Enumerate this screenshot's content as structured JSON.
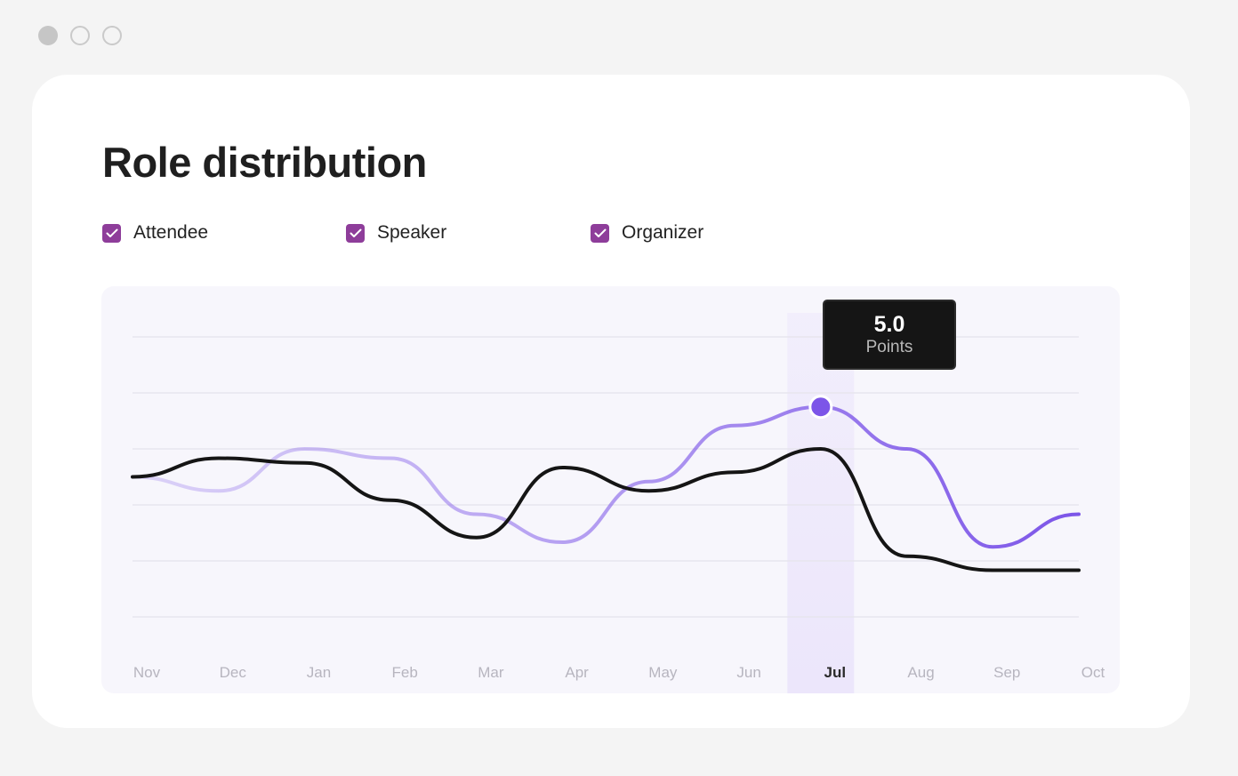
{
  "window": {
    "controls": [
      "close",
      "minimize",
      "maximize"
    ]
  },
  "card": {
    "title": "Role distribution"
  },
  "legend": [
    {
      "label": "Attendee",
      "checked": true
    },
    {
      "label": "Speaker",
      "checked": true
    },
    {
      "label": "Organizer",
      "checked": true
    }
  ],
  "colors": {
    "checkbox": "#8e3d9a",
    "purple_line": "#7c55e8",
    "dark_line": "#151515",
    "highlight_band": "#ece6fb",
    "panel_bg": "#f7f6fc"
  },
  "tooltip": {
    "value": "5.0",
    "label": "Points"
  },
  "chart_data": {
    "type": "line",
    "categories": [
      "Nov",
      "Dec",
      "Jan",
      "Feb",
      "Mar",
      "Apr",
      "May",
      "Jun",
      "Jul",
      "Aug",
      "Sep",
      "Oct"
    ],
    "highlighted_category": "Jul",
    "ylim": [
      0,
      6
    ],
    "grid": true,
    "series": [
      {
        "values": [
          3.0,
          2.7,
          3.6,
          3.4,
          2.2,
          1.6,
          2.9,
          4.1,
          4.5,
          3.6,
          1.5,
          2.2
        ]
      },
      {
        "values": [
          3.0,
          3.4,
          3.3,
          2.5,
          1.7,
          3.2,
          2.7,
          3.1,
          3.6,
          1.3,
          1.0,
          1.0
        ]
      }
    ]
  }
}
